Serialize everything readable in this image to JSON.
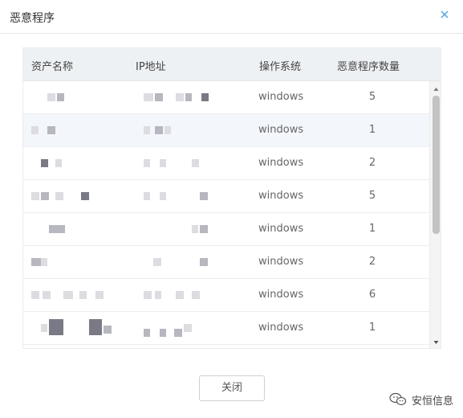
{
  "dialog": {
    "title": "恶意程序",
    "close_icon": "close-icon",
    "close_button_label": "关闭"
  },
  "table": {
    "columns": [
      "资产名称",
      "IP地址",
      "操作系统",
      "恶意程序数量"
    ],
    "rows": [
      {
        "os": "windows",
        "count": "5"
      },
      {
        "os": "windows",
        "count": "1"
      },
      {
        "os": "windows",
        "count": "2"
      },
      {
        "os": "windows",
        "count": "5"
      },
      {
        "os": "windows",
        "count": "1"
      },
      {
        "os": "windows",
        "count": "2"
      },
      {
        "os": "windows",
        "count": "6"
      },
      {
        "os": "windows",
        "count": "1"
      }
    ]
  },
  "scrollbar": {
    "up_icon": "scroll-up-arrow-icon",
    "down_icon": "scroll-down-arrow-icon",
    "position_fraction": 0
  },
  "watermark": {
    "icon": "wechat-icon",
    "text": "安恒信息"
  },
  "colors": {
    "header_bg": "#eef1f4",
    "alt_row_bg": "#f3f6fb",
    "close_icon": "#4aa3df"
  }
}
